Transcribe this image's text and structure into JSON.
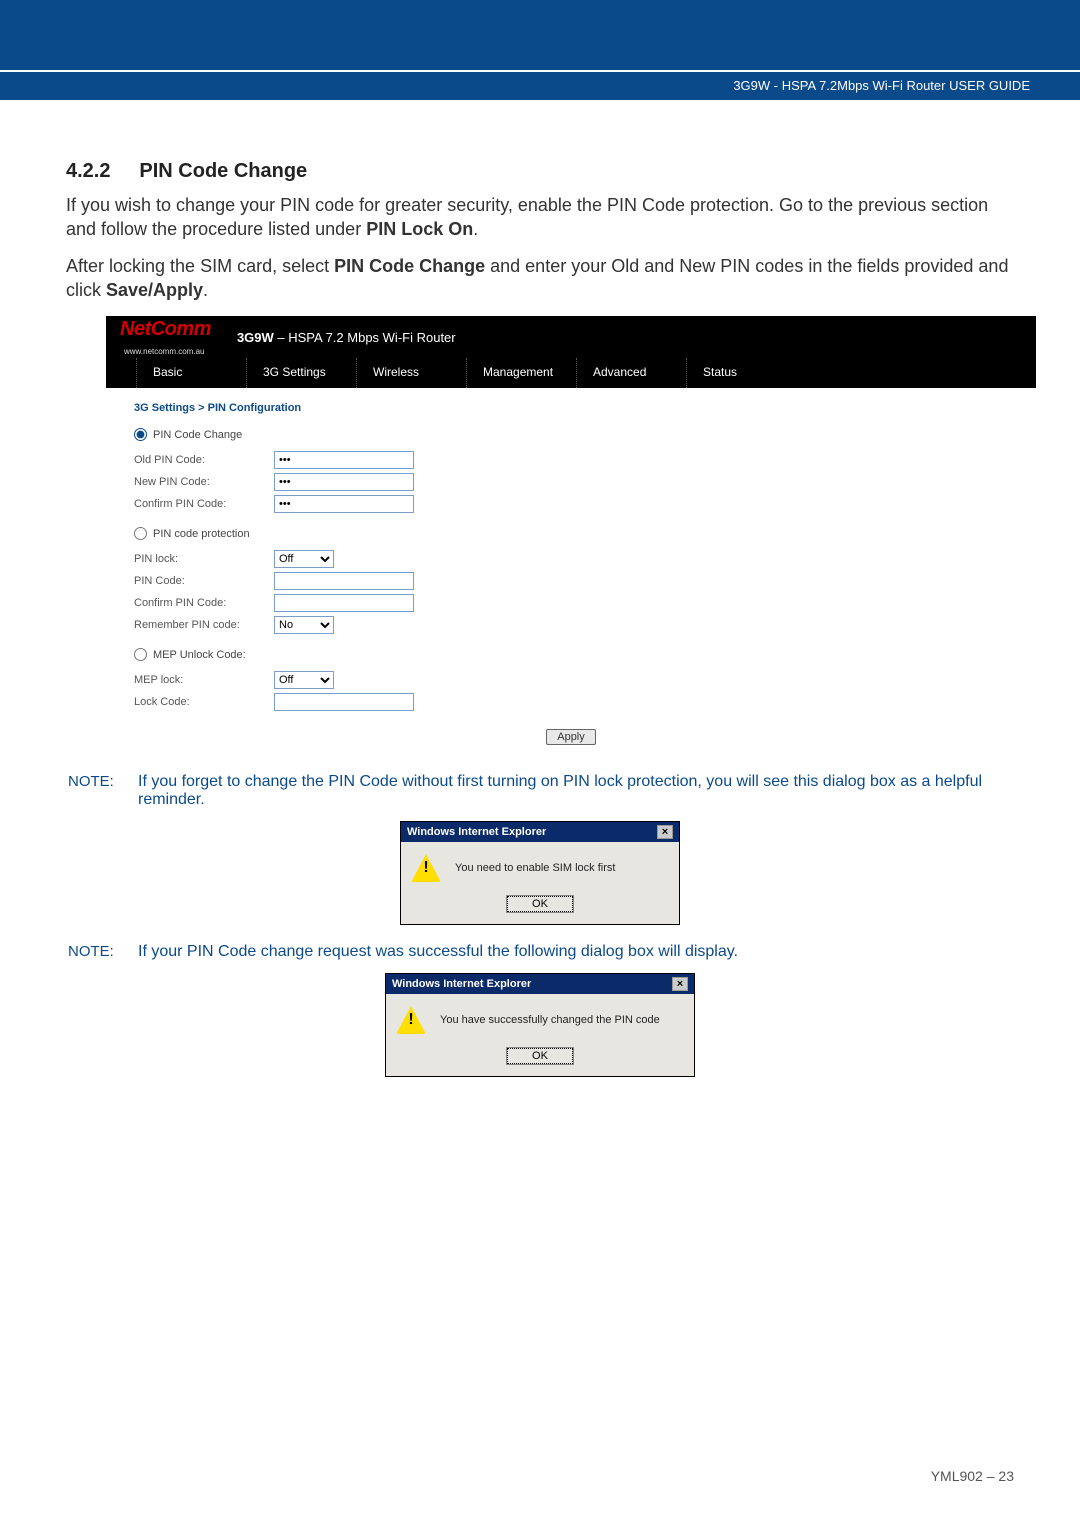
{
  "header": {
    "guide_text": "3G9W - HSPA 7.2Mbps Wi-Fi Router USER GUIDE"
  },
  "section": {
    "number": "4.2.2",
    "title": "PIN Code Change",
    "paragraph1_a": "If you wish to change your PIN code for greater security, enable the PIN Code protection. Go to the previous section and follow the procedure listed under ",
    "paragraph1_b": "PIN Lock On",
    "paragraph1_c": ".",
    "paragraph2_a": "After locking the SIM card, select ",
    "paragraph2_b": "PIN Code Change",
    "paragraph2_c": " and enter your Old and New PIN codes in the fields provided and click ",
    "paragraph2_d": "Save/Apply",
    "paragraph2_e": "."
  },
  "router": {
    "brand": "NetComm",
    "brand_sub": "www.netcomm.com.au",
    "title_bold": "3G9W",
    "title_rest": " – HSPA 7.2 Mbps Wi-Fi Router",
    "nav": [
      "Basic",
      "3G Settings",
      "Wireless",
      "Management",
      "Advanced",
      "Status"
    ],
    "breadcrumb": "3G Settings > PIN Configuration",
    "radios": {
      "pin_code_change": "PIN Code Change",
      "pin_code_protection": "PIN code protection",
      "mep_unlock_code": "MEP Unlock Code:"
    },
    "fields": {
      "old_pin": "Old PIN Code:",
      "new_pin": "New PIN Code:",
      "confirm_pin": "Confirm PIN Code:",
      "pin_lock": "PIN lock:",
      "pin_code": "PIN Code:",
      "confirm_pin2": "Confirm PIN Code:",
      "remember_pin": "Remember PIN code:",
      "mep_lock": "MEP lock:",
      "lock_code": "Lock Code:"
    },
    "values": {
      "old_pin": "•••",
      "new_pin": "•••",
      "confirm_pin": "•••",
      "pin_code": "",
      "confirm_pin2": "",
      "lock_code": ""
    },
    "selects": {
      "pin_lock": "Off",
      "remember_pin": "No",
      "mep_lock": "Off"
    },
    "apply": "Apply"
  },
  "notes": {
    "label": "NOTE:",
    "note1": "If you forget to change the PIN Code without first turning on PIN lock protection, you will see this dialog box as a helpful reminder.",
    "note2": "If your PIN Code change request was successful the following dialog box will display."
  },
  "dialog1": {
    "title": "Windows Internet Explorer",
    "message": "You need to enable SIM lock first",
    "ok": "OK"
  },
  "dialog2": {
    "title": "Windows Internet Explorer",
    "message": "You have successfully changed the PIN code",
    "ok": "OK"
  },
  "footer": {
    "text": "YML902 – 23"
  }
}
